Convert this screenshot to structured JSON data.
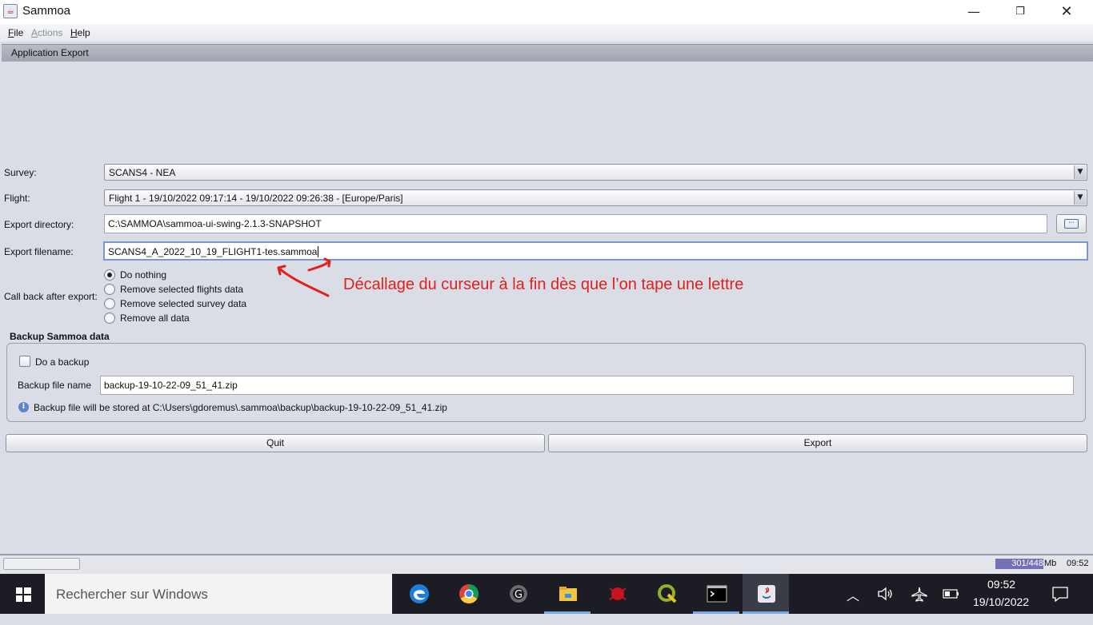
{
  "window": {
    "title": "Sammoa",
    "min_symbol": "—",
    "max_symbol": "❐",
    "close_symbol": "✕"
  },
  "menu": {
    "file_first": "F",
    "file_rest": "ile",
    "actions_first": "A",
    "actions_rest": "ctions",
    "help_first": "H",
    "help_rest": "elp"
  },
  "section": {
    "title": "Application Export"
  },
  "form": {
    "survey_label": "Survey:",
    "survey_value": "SCANS4 - NEA",
    "flight_label": "Flight:",
    "flight_value": "Flight 1 - 19/10/2022 09:17:14 - 19/10/2022 09:26:38 - [Europe/Paris]",
    "export_dir_label": "Export directory:",
    "export_dir_value": "C:\\SAMMOA\\sammoa-ui-swing-2.1.3-SNAPSHOT",
    "browse_symbol": "···",
    "export_filename_label": "Export filename:",
    "export_filename_value": "SCANS4_A_2022_10_19_FLIGHT1-tes.sammoa",
    "callback_label": "Call back after export:",
    "callback_options": [
      "Do nothing",
      "Remove selected flights data",
      "Remove selected survey data",
      "Remove all data"
    ],
    "callback_selected": 0
  },
  "backup": {
    "title": "Backup Sammoa data",
    "checkbox_label": "Do a backup",
    "checkbox_checked": false,
    "file_name_label": "Backup file name",
    "file_name_value": "backup-19-10-22-09_51_41.zip",
    "info_symbol": "i",
    "info_text": "Backup file will be stored at C:\\Users\\gdoremus\\.sammoa\\backup\\backup-19-10-22-09_51_41.zip"
  },
  "buttons": {
    "quit": "Quit",
    "export": "Export"
  },
  "annotation": {
    "text": "Décallage du curseur à la fin dès que l’on tape une lettre",
    "color": "#e0201c"
  },
  "status": {
    "memory": "301/448",
    "memory_unit": "Mb",
    "time": "09:52"
  },
  "taskbar": {
    "search_placeholder": "Rechercher sur Windows",
    "apps": [
      "edge-icon",
      "chrome-icon",
      "inkscape-icon",
      "file-explorer-icon",
      "bug-app-icon",
      "qgis-icon",
      "terminal-icon",
      "java-icon"
    ],
    "clock_time": "09:52",
    "clock_date": "19/10/2022"
  }
}
